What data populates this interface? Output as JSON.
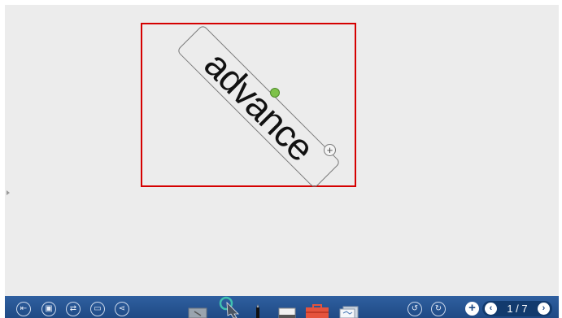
{
  "canvas": {
    "selected_text": "advance"
  },
  "toolbar": {
    "left_buttons": [
      {
        "icon": "exit-icon",
        "glyph": "⇤"
      },
      {
        "icon": "save-icon",
        "glyph": "▣"
      },
      {
        "icon": "switch-icon",
        "glyph": "⇄"
      },
      {
        "icon": "record-icon",
        "glyph": "▭"
      },
      {
        "icon": "share-icon",
        "glyph": "⋖"
      }
    ],
    "undo_glyph": "↺",
    "redo_glyph": "↻",
    "add_glyph": "+",
    "prev_glyph": "‹",
    "next_glyph": "›",
    "page_counter": "1 / 7"
  },
  "colors": {
    "selection_border": "#d50000",
    "toolbar": "#1f4a85",
    "rotate_handle": "#7ec24a"
  }
}
